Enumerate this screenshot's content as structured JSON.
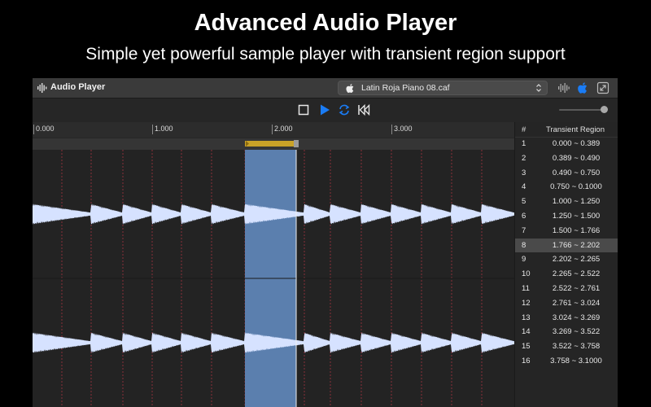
{
  "headline": "Advanced Audio Player",
  "subhead": "Simple yet powerful sample player with transient region support",
  "window": {
    "title": "Audio Player",
    "file_name": "Latin Roja Piano 08.caf",
    "toolbar_icons": [
      "waveform-icon",
      "apple-icon",
      "resize-icon"
    ],
    "accent": "#1a7cf5"
  },
  "transport": {
    "stop": "stop-icon",
    "play": "play-icon",
    "loop": "loop-icon",
    "rewind": "rewind-icon",
    "volume": 0.95
  },
  "ruler": {
    "ticks": [
      "0.000",
      "1.000",
      "2.000",
      "3.000"
    ]
  },
  "table": {
    "header_num": "#",
    "header_region": "Transient Region",
    "selected_index": 7,
    "rows": [
      {
        "num": "1",
        "region": "0.000 ~ 0.389"
      },
      {
        "num": "2",
        "region": "0.389 ~ 0.490"
      },
      {
        "num": "3",
        "region": "0.490 ~ 0.750"
      },
      {
        "num": "4",
        "region": "0.750 ~ 0.1000"
      },
      {
        "num": "5",
        "region": "1.000 ~ 1.250"
      },
      {
        "num": "6",
        "region": "1.250 ~ 1.500"
      },
      {
        "num": "7",
        "region": "1.500 ~ 1.766"
      },
      {
        "num": "8",
        "region": "1.766 ~ 2.202"
      },
      {
        "num": "9",
        "region": "2.202 ~ 2.265"
      },
      {
        "num": "10",
        "region": "2.265 ~ 2.522"
      },
      {
        "num": "11",
        "region": "2.522 ~ 2.761"
      },
      {
        "num": "12",
        "region": "2.761 ~ 3.024"
      },
      {
        "num": "13",
        "region": "3.024 ~ 3.269"
      },
      {
        "num": "14",
        "region": "3.269 ~ 3.522"
      },
      {
        "num": "15",
        "region": "3.522 ~ 3.758"
      },
      {
        "num": "16",
        "region": "3.758 ~ 3.1000"
      }
    ]
  },
  "colors": {
    "waveform": "#d6e2ff",
    "selection": "#5b7fae",
    "transient_marker": "#8a2f3a",
    "region_handle": "#c9a227"
  }
}
